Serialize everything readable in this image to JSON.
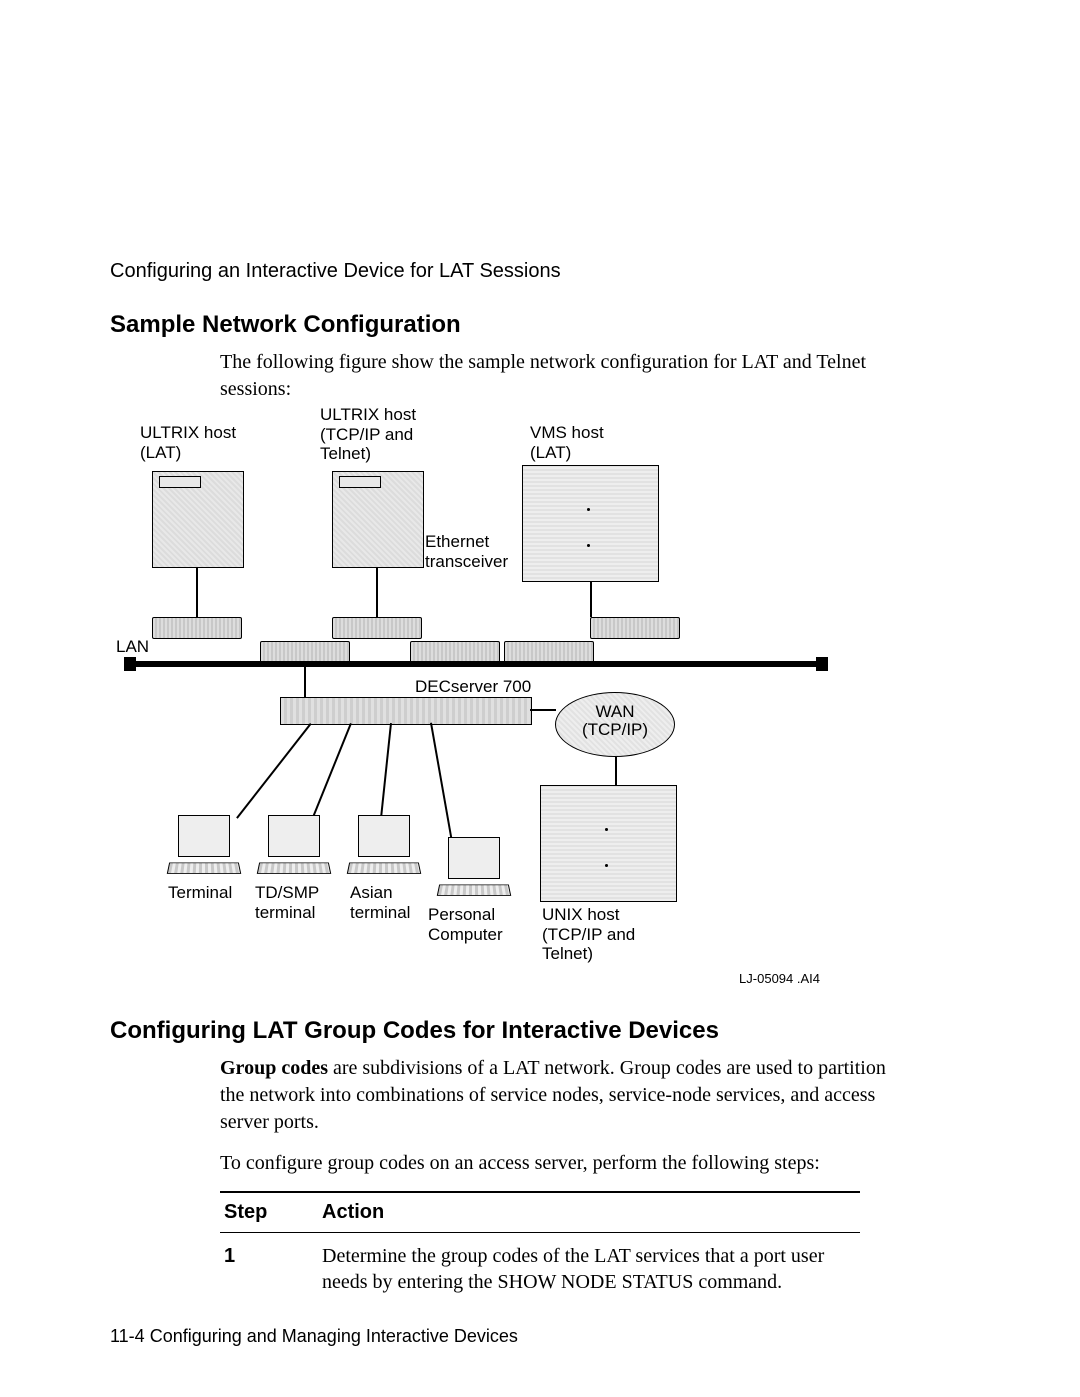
{
  "header": {
    "breadcrumb": "Configuring an Interactive Device for LAT Sessions"
  },
  "section1": {
    "heading": "Sample Network Configuration",
    "intro": "The following figure show the sample network configuration for LAT and Telnet sessions:"
  },
  "diagram": {
    "ultrix_lat": "ULTRIX host\n(LAT)",
    "ultrix_tcp": "ULTRIX host\n(TCP/IP and\nTelnet)",
    "vms_lat": "VMS host\n(LAT)",
    "eth_trans": "Ethernet\ntransceiver",
    "lan": "LAN",
    "decserver": "DECserver 700",
    "wan": "WAN\n(TCP/IP)",
    "terminal": "Terminal",
    "tdsmp": "TD/SMP\nterminal",
    "asian": "Asian\nterminal",
    "pc": "Personal\nComputer",
    "unix_host": "UNIX host\n(TCP/IP and\nTelnet)",
    "fig_ref": "LJ-05094 .AI4"
  },
  "section2": {
    "heading": "Configuring LAT Group Codes for Interactive Devices",
    "para_bold": "Group codes",
    "para_rest": " are subdivisions of a LAT network. Group codes are used to partition the network into combinations of service nodes, service-node services, and access server ports.",
    "para2": "To configure group codes on an access server, perform the following steps:"
  },
  "table": {
    "col_step": "Step",
    "col_action": "Action",
    "rows": [
      {
        "step": "1",
        "action": "Determine the group codes of the LAT services that a port user needs by entering the SHOW NODE STATUS command."
      }
    ]
  },
  "footer": {
    "text": "11-4  Configuring and Managing Interactive Devices"
  }
}
